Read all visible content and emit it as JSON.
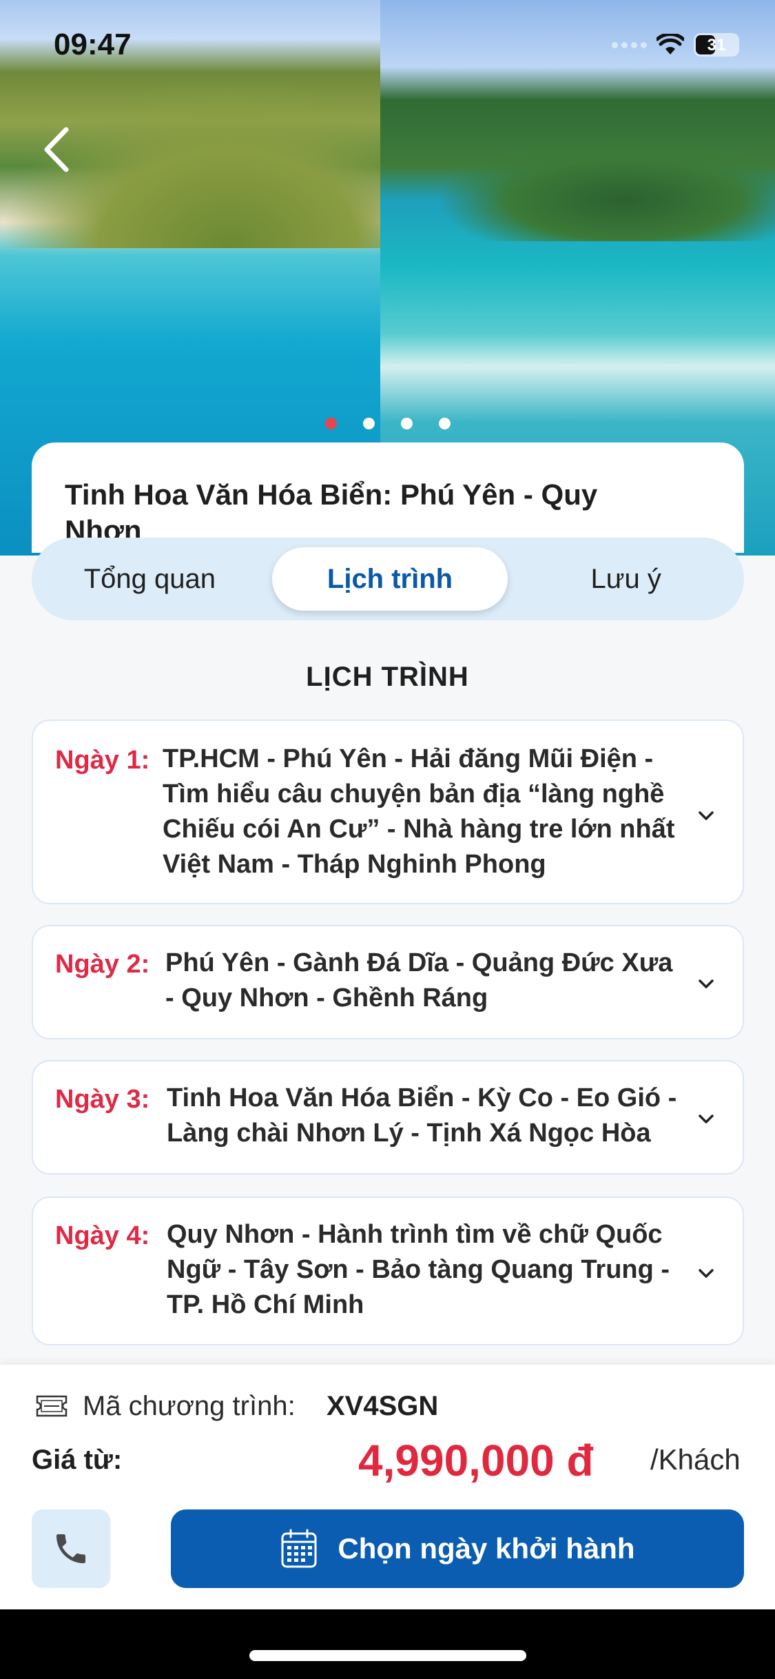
{
  "status_bar": {
    "time": "09:47",
    "battery": "31"
  },
  "carousel": {
    "slide_count": 4,
    "active_index": 0
  },
  "tour": {
    "title": "Tinh Hoa Văn Hóa Biển: Phú Yên - Quy Nhơn"
  },
  "tabs": [
    {
      "label": "Tổng quan",
      "active": false
    },
    {
      "label": "Lịch trình",
      "active": true
    },
    {
      "label": "Lưu ý",
      "active": false
    }
  ],
  "itinerary": {
    "title": "LỊCH TRÌNH",
    "days": [
      {
        "label": "Ngày 1:",
        "desc": "TP.HCM - Phú Yên - Hải đăng Mũi Điện - Tìm hiểu câu chuyện bản địa “làng nghề Chiếu cói An Cư” - Nhà hàng tre lớn nhất Việt Nam - Tháp Nghinh Phong"
      },
      {
        "label": "Ngày 2:",
        "desc": "Phú Yên - Gành Đá Dĩa - Quảng Đức Xưa - Quy Nhơn - Ghềnh Ráng"
      },
      {
        "label": "Ngày 3:",
        "desc": "Tinh Hoa Văn Hóa Biển - Kỳ Co - Eo Gió - Làng chài Nhơn Lý - Tịnh Xá Ngọc Hòa"
      },
      {
        "label": "Ngày 4:",
        "desc": "Quy Nhơn - Hành trình tìm về chữ Quốc Ngữ - Tây Sơn - Bảo tàng Quang Trung - TP. Hồ Chí Minh"
      }
    ]
  },
  "footer": {
    "code_label": "Mã chương trình:",
    "code_value": "XV4SGN",
    "price_label": "Giá từ:",
    "price_value": "4,990,000 đ",
    "price_unit": "/Khách",
    "cta_label": "Chọn ngày khởi hành"
  },
  "colors": {
    "accent": "#0a5db0",
    "price": "#e0283f",
    "day_label": "#de2a45",
    "tab_bg": "#dcecf8"
  }
}
